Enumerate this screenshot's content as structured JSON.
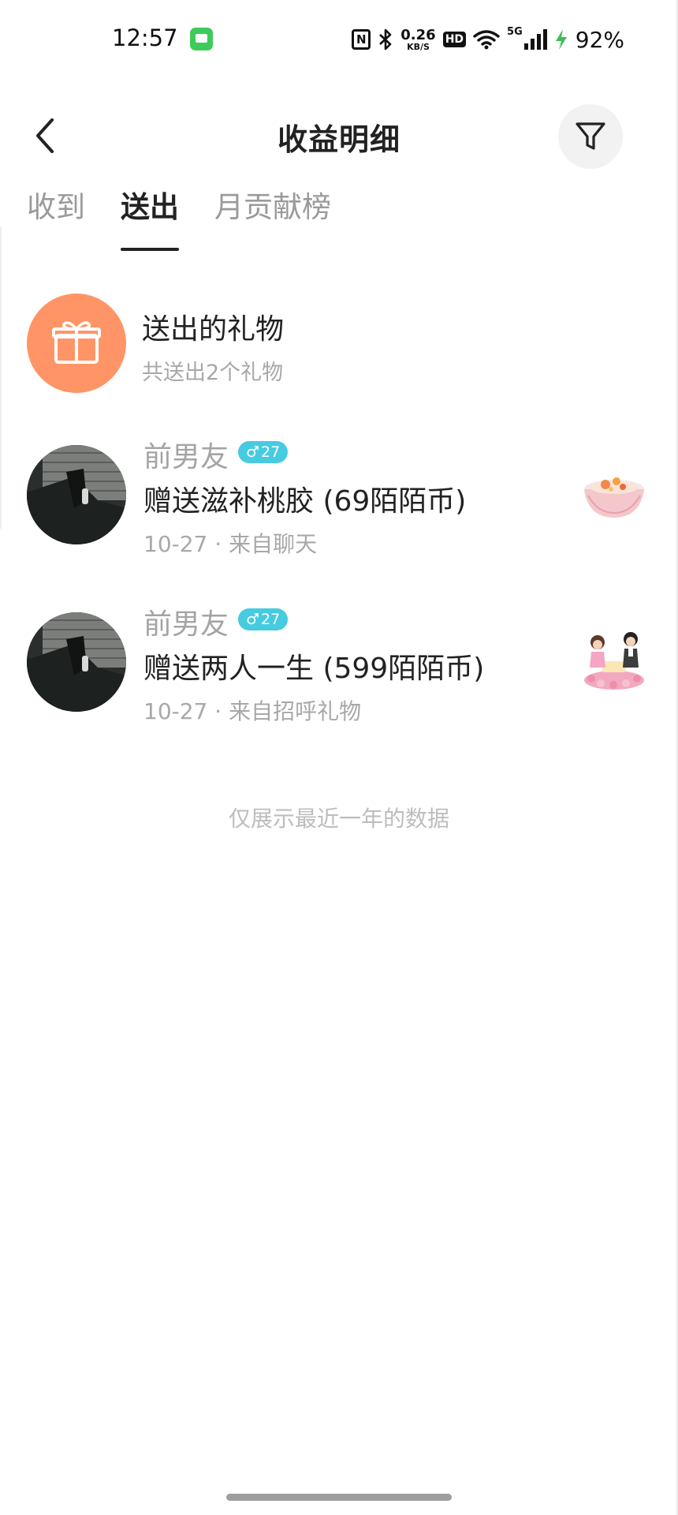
{
  "status_bar": {
    "time": "12:57",
    "speed_value": "0.26",
    "speed_unit": "KB/S",
    "hd": "HD",
    "network": "5G",
    "battery": "92%",
    "icons": [
      "message-icon",
      "nfc-icon",
      "bluetooth-icon",
      "wifi-icon",
      "signal-icon",
      "charging-icon"
    ]
  },
  "header": {
    "title": "收益明细",
    "back_icon": "chevron-left-icon",
    "filter_icon": "filter-icon"
  },
  "tabs": [
    {
      "label": "收到",
      "active": false
    },
    {
      "label": "送出",
      "active": true
    },
    {
      "label": "月贡献榜",
      "active": false
    }
  ],
  "summary": {
    "icon": "gift-icon",
    "icon_color": "#ff9566",
    "title": "送出的礼物",
    "subtitle": "共送出2个礼物"
  },
  "records": [
    {
      "name": "前男友",
      "gender_symbol": "♂",
      "age": "27",
      "description": "赠送滋补桃胶 (69陌陌币)",
      "meta": "10-27 · 来自聊天",
      "gift_icon": "peach-gum-dessert-icon"
    },
    {
      "name": "前男友",
      "gender_symbol": "♂",
      "age": "27",
      "description": "赠送两人一生 (599陌陌币)",
      "meta": "10-27 · 来自招呼礼物",
      "gift_icon": "couple-gift-icon"
    }
  ],
  "footer_note": "仅展示最近一年的数据",
  "colors": {
    "accent_orange": "#ff9566",
    "badge_blue": "#46cbe0",
    "text_primary": "#222222",
    "text_secondary": "#a8a8a8"
  }
}
